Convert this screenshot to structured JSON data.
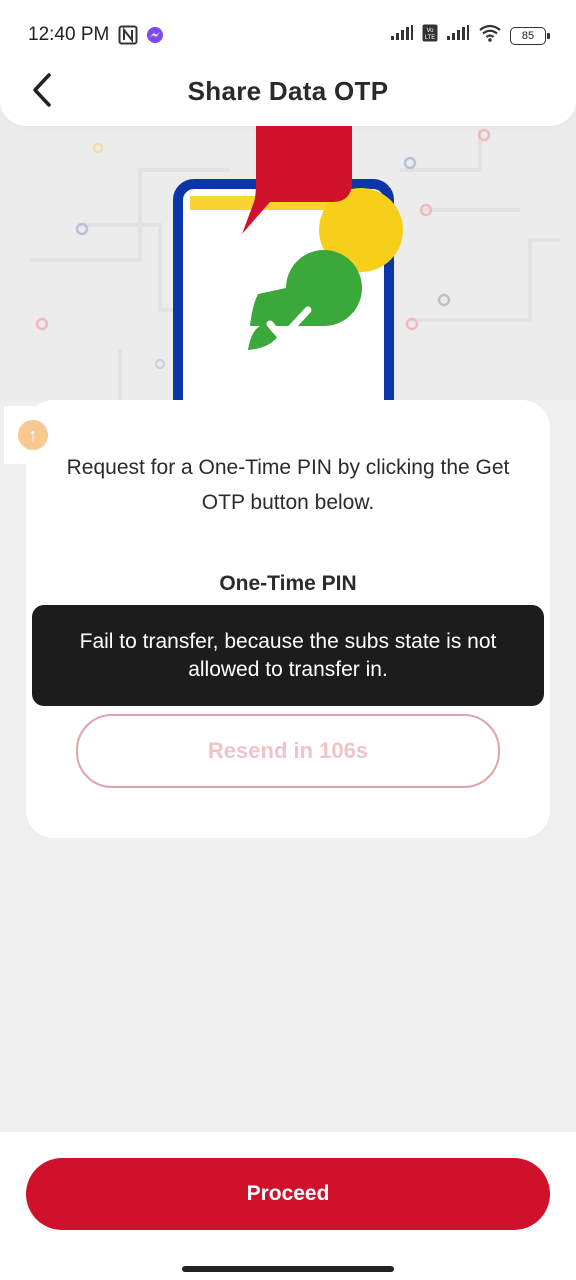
{
  "status_bar": {
    "time": "12:40 PM",
    "left_icons": [
      "nfc-icon",
      "messenger-icon"
    ],
    "right_icons": [
      "signal-icon",
      "volte-icon",
      "signal-icon",
      "wifi-icon"
    ],
    "battery": "85"
  },
  "header": {
    "title": "Share Data OTP",
    "back_icon": "chevron-left-icon"
  },
  "hero": {
    "illustration": "phone-check-illustration",
    "colors": {
      "phone_frame": "#0a36a8",
      "bubble_red": "#d0112b",
      "bubble_yellow": "#f6cf1b",
      "check_green": "#3aa83a"
    }
  },
  "floating_badge": {
    "label": "↑"
  },
  "card": {
    "instruction": "Request for a One-Time PIN by clicking the Get OTP button below.",
    "otp_label": "One-Time PIN",
    "otp_value": "",
    "resend_label": "Resend in 106s"
  },
  "toast": {
    "message": "Fail to transfer, because the subs state is not allowed to transfer in."
  },
  "footer": {
    "proceed_label": "Proceed"
  },
  "colors": {
    "accent": "#d0112b",
    "background": "#efefef",
    "toast_bg": "#1c1c1c"
  }
}
